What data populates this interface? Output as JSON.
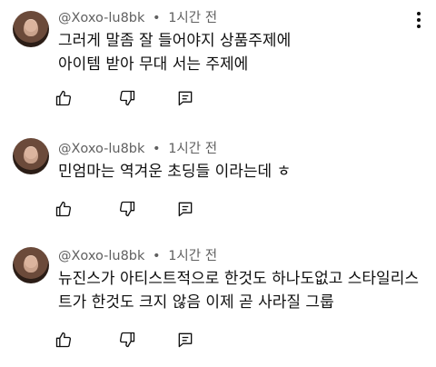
{
  "comments": [
    {
      "author": "@Xoxo-lu8bk",
      "separator": "•",
      "time": "1시간 전",
      "lines": [
        "그러게 말좀 잘 들어야지 상품주제에",
        "아이템 받아 무대 서는 주제에"
      ]
    },
    {
      "author": "@Xoxo-lu8bk",
      "separator": "•",
      "time": "1시간 전",
      "lines": [
        "민엄마는 역겨운 초딩들 이라는데 ㅎ"
      ]
    },
    {
      "author": "@Xoxo-lu8bk",
      "separator": "•",
      "time": "1시간 전",
      "lines": [
        "뉴진스가 아티스트적으로 한것도 하나도없고 스타일리스",
        "트가 한것도 크지 않음 이제 곧 사라질 그룹"
      ]
    }
  ],
  "icons": {
    "like": "thumbs-up-icon",
    "dislike": "thumbs-down-icon",
    "reply": "reply-comment-icon",
    "more": "more-vertical-icon"
  }
}
